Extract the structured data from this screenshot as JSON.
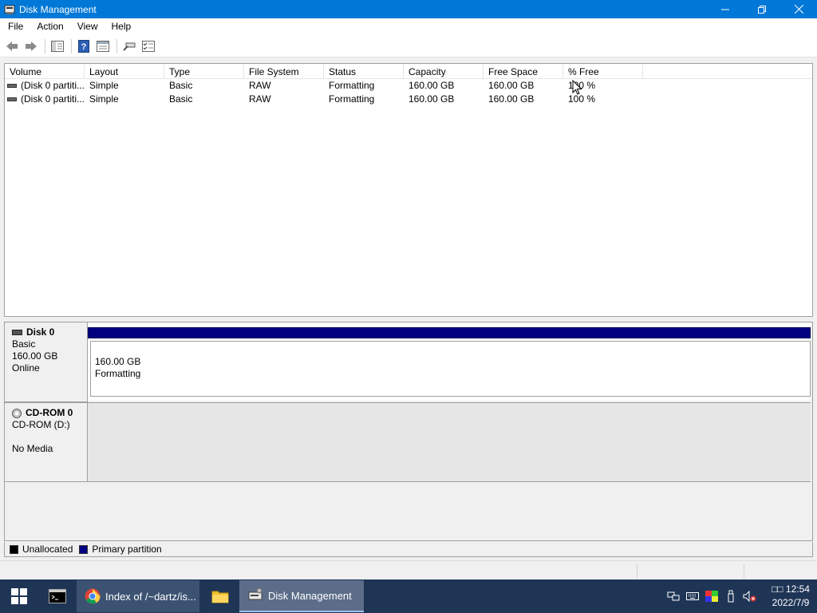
{
  "window": {
    "title": "Disk Management"
  },
  "menu": [
    "File",
    "Action",
    "View",
    "Help"
  ],
  "toolbar": {
    "icons": [
      "back-icon",
      "forward-icon",
      "show-hide-console-tree-icon",
      "help-icon",
      "properties-icon",
      "connect-icon",
      "checklist-icon"
    ]
  },
  "volume_list": {
    "columns": [
      "Volume",
      "Layout",
      "Type",
      "File System",
      "Status",
      "Capacity",
      "Free Space",
      "% Free"
    ],
    "rows": [
      [
        "(Disk 0 partiti...",
        "Simple",
        "Basic",
        "RAW",
        "Formatting",
        "160.00 GB",
        "160.00 GB",
        "100 %"
      ],
      [
        "(Disk 0 partiti...",
        "Simple",
        "Basic",
        "RAW",
        "Formatting",
        "160.00 GB",
        "160.00 GB",
        "100 %"
      ]
    ]
  },
  "disks": [
    {
      "name": "Disk 0",
      "type": "Basic",
      "size": "160.00 GB",
      "state": "Online",
      "partition": {
        "size": "160.00 GB",
        "status": "Formatting"
      }
    },
    {
      "name": "CD-ROM 0",
      "type": "CD-ROM (D:)",
      "state": "No Media"
    }
  ],
  "legend": [
    {
      "label": "Unallocated",
      "color": "#000000"
    },
    {
      "label": "Primary partition",
      "color": "#000080"
    }
  ],
  "taskbar": {
    "tasks": [
      {
        "label": "Index of /~dartz/is...",
        "icon": "chrome-icon"
      },
      {
        "label": "Disk Management",
        "icon": "disk-management-icon"
      }
    ],
    "clock": {
      "time": "□□ 12:54",
      "date": "2022/7/9"
    }
  }
}
